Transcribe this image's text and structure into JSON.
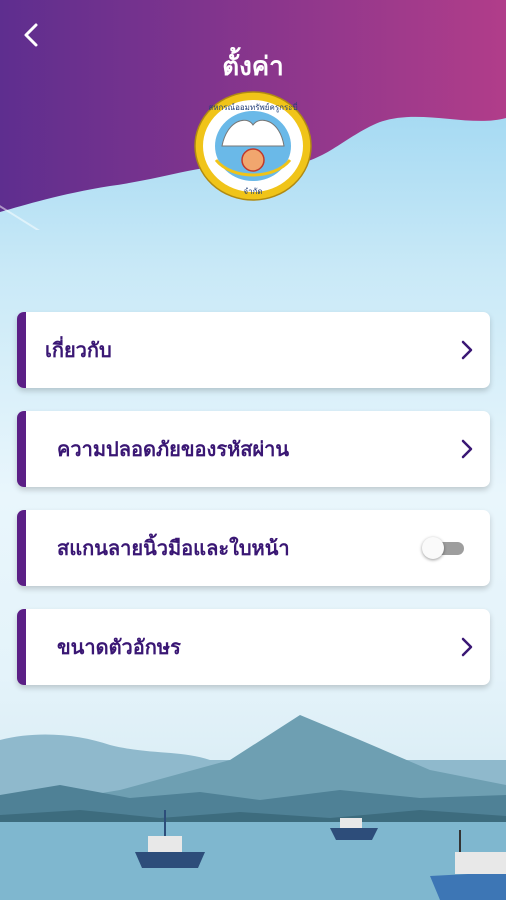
{
  "header": {
    "title": "ตั้งค่า",
    "back_icon": "chevron-left-icon",
    "gradient": [
      "#5e2e8f",
      "#b13d8a"
    ]
  },
  "logo": {
    "name": "cooperative-emblem",
    "ring_text": "สหกรณ์ออมทรัพย์ครูกระบี่",
    "bottom_text": "จำกัด"
  },
  "menu": {
    "accent": "#5b1f86",
    "text_color": "#3a1774",
    "items": [
      {
        "label": "เกี่ยวกับ",
        "control": "chevron-right-icon"
      },
      {
        "label": "ความปลอดภัยของรหัสผ่าน",
        "control": "chevron-right-icon"
      },
      {
        "label": "สแกนลายนิ้วมือและใบหน้า",
        "control": "toggle",
        "enabled": false
      },
      {
        "label": "ขนาดตัวอักษร",
        "control": "chevron-right-icon"
      }
    ]
  }
}
